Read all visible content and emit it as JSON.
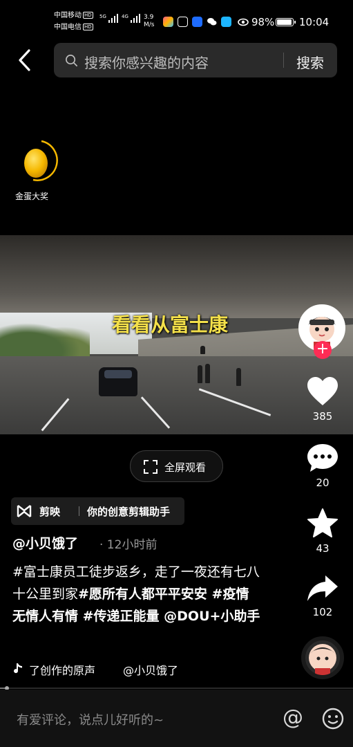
{
  "status_bar": {
    "carrier1": "中国移动",
    "carrier2": "中国电信",
    "hd": "HD",
    "net1": "5G",
    "net2": "4G",
    "speed_value": "3.9",
    "speed_unit": "M/s",
    "battery_pct": "98%",
    "battery_level": 0.98,
    "time": "10:04"
  },
  "search": {
    "placeholder": "搜索你感兴趣的内容",
    "button_label": "搜索"
  },
  "award": {
    "label": "金蛋大奖"
  },
  "video": {
    "caption": "看看从富士康",
    "fullscreen_label": "全屏观看"
  },
  "side_actions": {
    "likes": "385",
    "comments": "20",
    "favorites": "43",
    "shares": "102"
  },
  "capcut": {
    "name": "剪映",
    "slogan": "你的创意剪辑助手"
  },
  "post": {
    "author": "@小贝饿了",
    "time": "· 12小时前",
    "desc_part1": "#富士康员工徒步返乡，走了一夜还有七八十公里到家",
    "desc_part2": "#愿所有人都平平安安 #疫情无情人有情 #传递正能量 @DOU+小助手"
  },
  "music": {
    "title": "了创作的原声",
    "author": "@小贝饿了"
  },
  "progress": {
    "fraction": 0.02
  },
  "comment": {
    "placeholder": "有爱评论，说点儿好听的~",
    "at_symbol": "@"
  },
  "colors": {
    "accent_red": "#fe2c55",
    "caption_yellow": "#f4e04a",
    "egg_gold": "#f5b800"
  }
}
